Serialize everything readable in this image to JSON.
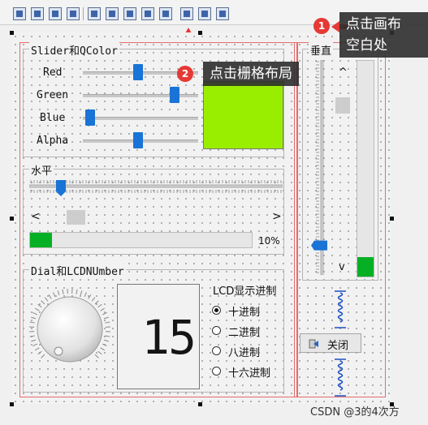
{
  "callouts": [
    {
      "badge": "1",
      "text_line1": "点击画布",
      "text_line2": "空白处"
    },
    {
      "badge": "2",
      "text": "点击栅格布局"
    }
  ],
  "slider_group": {
    "title": "Slider和QColor",
    "rows": [
      {
        "label": "Red",
        "value": 0.48
      },
      {
        "label": "Green",
        "value": 0.82
      },
      {
        "label": "Blue",
        "value": 0.02
      },
      {
        "label": "Alpha",
        "value": 0.48
      }
    ],
    "swatch_color": "#99ee00"
  },
  "horizontal_group": {
    "title": "水平",
    "slider_value": 0.11,
    "scroll_left": "<",
    "scroll_right": ">",
    "progress_percent": 10,
    "progress_text": "10%"
  },
  "dial_group": {
    "title": "Dial和LCDNUmber",
    "lcd_value": "15",
    "radio_title": "LCD显示进制",
    "radios": [
      {
        "label": "十进制",
        "checked": true
      },
      {
        "label": "二进制",
        "checked": false
      },
      {
        "label": "八进制",
        "checked": false
      },
      {
        "label": "十六进制",
        "checked": false
      }
    ]
  },
  "vertical_group": {
    "title": "垂直",
    "slider_value": 0.12,
    "progress_value": 0.09,
    "scroll_up": "^",
    "scroll_down": "v"
  },
  "close_button": {
    "label": "关闭"
  },
  "watermark": "CSDN @3的4次方",
  "colors": {
    "accent_blue": "#1a73d6",
    "red_outline": "#e66b6b",
    "callout_bg": "#2d2d2d",
    "progress_green": "#00b43b"
  }
}
